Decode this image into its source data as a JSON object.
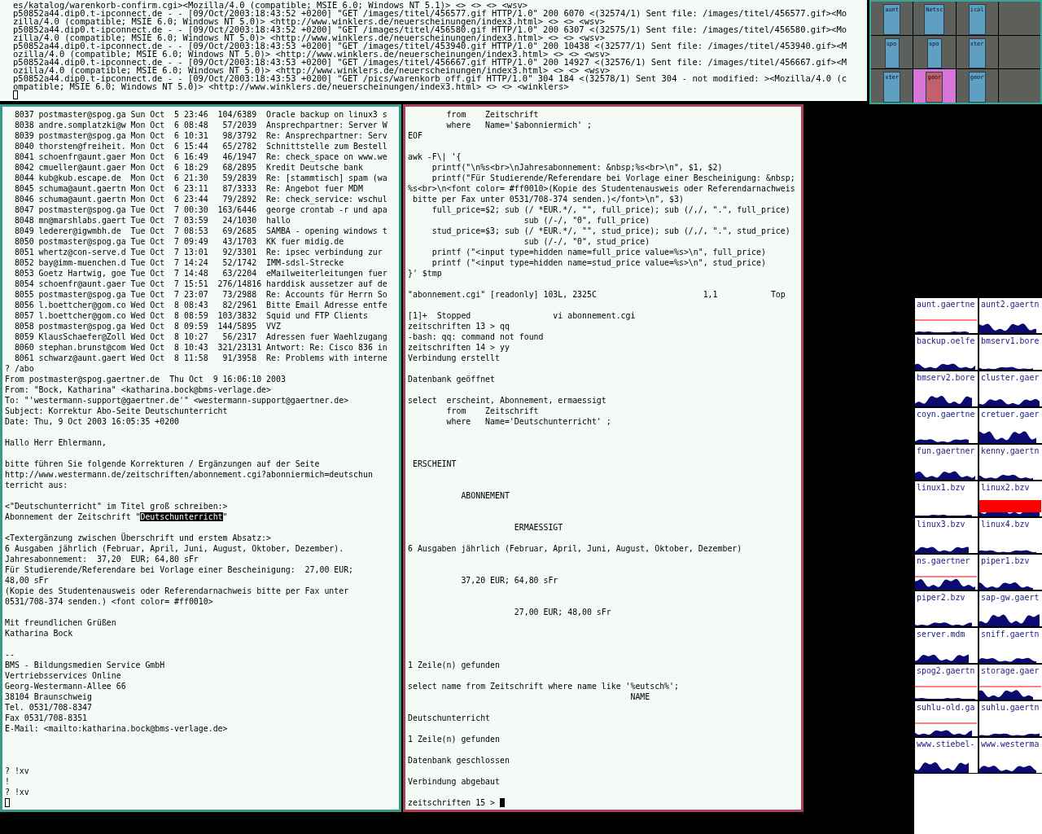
{
  "log_terminal": {
    "lines": [
      "es/katalog/warenkorb-confirm.cgi><Mozilla/4.0 (compatible; MSIE 6.0; Windows NT 5.1)> <> <> <> <wsv>",
      "p50852a44.dip0.t-ipconnect.de - - [09/Oct/2003:18:43:52 +0200] \"GET /images/titel/456577.gif HTTP/1.0\" 200 6070 <(32574/1) Sent file: /images/titel/456577.gif><Mo",
      "zilla/4.0 (compatible; MSIE 6.0; Windows NT 5.0)> <http://www.winklers.de/neuerscheinungen/index3.html> <> <> <wsv>",
      "p50852a44.dip0.t-ipconnect.de - - [09/Oct/2003:18:43:52 +0200] \"GET /images/titel/456580.gif HTTP/1.0\" 200 6307 <(32575/1) Sent file: /images/titel/456580.gif><Mo",
      "zilla/4.0 (compatible; MSIE 6.0; Windows NT 5.0)> <http://www.winklers.de/neuerscheinungen/index3.html> <> <> <wsv>",
      "p50852a44.dip0.t-ipconnect.de - - [09/Oct/2003:18:43:53 +0200] \"GET /images/titel/453940.gif HTTP/1.0\" 200 10438 <(32577/1) Sent file: /images/titel/453940.gif><M",
      "ozilla/4.0 (compatible; MSIE 6.0; Windows NT 5.0)> <http://www.winklers.de/neuerscheinungen/index3.html> <> <> <wsv>",
      "p50852a44.dip0.t-ipconnect.de - - [09/Oct/2003:18:43:53 +0200] \"GET /images/titel/456667.gif HTTP/1.0\" 200 14927 <(32576/1) Sent file: /images/titel/456667.gif><M",
      "ozilla/4.0 (compatible; MSIE 6.0; Windows NT 5.0)> <http://www.winklers.de/neuerscheinungen/index3.html> <> <> <wsv>",
      "p50852a44.dip0.t-ipconnect.de - - [09/Oct/2003:18:43:53 +0200] \"GET /pics/warenkorb_off.gif HTTP/1.0\" 304 184 <(32578/1) Sent 304 - not modified: ><Mozilla/4.0 (c",
      "ompatible; MSIE 6.0; Windows NT 5.0)> <http://www.winklers.de/neuerscheinungen/index3.html> <> <> <winklers>"
    ]
  },
  "pager": {
    "desks": [
      {
        "selected": false,
        "windows": [
          {
            "label": "aunt",
            "focused": false
          }
        ]
      },
      {
        "selected": false,
        "windows": [
          {
            "label": "Netsc",
            "focused": false
          }
        ]
      },
      {
        "selected": false,
        "windows": [
          {
            "label": "ical",
            "focused": false
          }
        ]
      },
      {
        "selected": false
      },
      {
        "selected": false,
        "windows": [
          {
            "label": "spo",
            "focused": false
          }
        ]
      },
      {
        "selected": false,
        "windows": [
          {
            "label": "spo",
            "focused": false
          }
        ]
      },
      {
        "selected": false,
        "windows": [
          {
            "label": "xter",
            "focused": false
          }
        ]
      },
      {
        "selected": false
      },
      {
        "selected": false,
        "windows": [
          {
            "label": "xter",
            "focused": false
          }
        ]
      },
      {
        "selected": true,
        "windows": [
          {
            "label": "geor",
            "focused": true
          }
        ]
      },
      {
        "selected": false,
        "windows": [
          {
            "label": "geor",
            "focused": false
          }
        ]
      },
      {
        "selected": false
      }
    ]
  },
  "terminals": [
    {
      "focused": false,
      "blocks": [
        {
          "kind": "tight",
          "lines": [
            "  8037 postmaster@spog.ga Sun Oct  5 23:46  104/6389  Oracle backup on linux3 s",
            "  8038 andre.somplatzki@w Mon Oct  6 08:48   57/2039  Ansprechpartner: Server W",
            "  8039 postmaster@spog.ga Mon Oct  6 10:31   98/3792  Re: Ansprechpartner: Serv",
            "  8040 thorsten@freiheit. Mon Oct  6 15:44   65/2782  Schnittstelle zum Bestell",
            "  8041 schoenfr@aunt.gaer Mon Oct  6 16:49   46/1947  Re: check_space on www.we",
            "  8042 cmueller@aunt.gaer Mon Oct  6 18:29   68/2895  Kredit Deutsche bank",
            "  8044 kub@kub.escape.de  Mon Oct  6 21:30   59/2839  Re: [stammtisch] spam (wa",
            "  8045 schuma@aunt.gaertn Mon Oct  6 23:11   87/3333  Re: Angebot fuer MDM",
            "  8046 schuma@aunt.gaertn Mon Oct  6 23:44   79/2892  Re: check_service: wschul",
            "  8047 postmaster@spog.ga Tue Oct  7 00:30  163/6446  george crontab -r und apa",
            "  8048 mn@marshlabs.gaert Tue Oct  7 03:59   24/1030  hallo",
            "  8049 lederer@igwmbh.de  Tue Oct  7 08:53   69/2685  SAMBA - opening windows t",
            "  8050 postmaster@spog.ga Tue Oct  7 09:49   43/1703  KK fuer midig.de",
            "  8051 whertz@con-serve.d Tue Oct  7 13:01   92/3301  Re: ipsec verbindung zur",
            "  8052 bay@imm-muenchen.d Tue Oct  7 14:24   52/1742  IMM-sdsl-Strecke",
            "  8053 Goetz Hartwig, goe Tue Oct  7 14:48   63/2204  eMailweiterleitungen fuer",
            "  8054 schoenfr@aunt.gaer Tue Oct  7 15:51  276/14816 harddisk aussetzer auf de",
            "  8055 postmaster@spog.ga Tue Oct  7 23:07   73/2988  Re: Accounts für Herrn So",
            "  8056 l.boettcher@gom.co Wed Oct  8 08:43   82/2961  Bitte Email Adresse entfe",
            "  8057 l.boettcher@gom.co Wed Oct  8 08:59  103/3832  Squid und FTP Clients",
            "  8058 postmaster@spog.ga Wed Oct  8 09:59  144/5895  VVZ",
            "  8059 KlausSchaefer@Zoll Wed Oct  8 10:27   56/2317  Adressen fuer Waehlzugang",
            "  8060 stephan.brunst@com Wed Oct  8 10:43  321/23131 Antwort: Re: Cisco 836 in",
            "  8061 schwarz@aunt.gaert Wed Oct  8 11:58   91/3958  Re: Problems with interne",
            "? /abo",
            "From postmaster@spog.gaertner.de  Thu Oct  9 16:06:10 2003",
            "From: \"Bock, Katharina\" <katharina.bock@bms-verlage.de>",
            "To: \"'westermann-support@gaertner.de'\" <westermann-support@gaertner.de>",
            "Subject: Korrektur Abo-Seite Deutschunterricht",
            "Date: Thu, 9 Oct 2003 16:05:35 +0200"
          ]
        },
        {
          "kind": "single",
          "lines": [
            "Hallo Herr Ehlermann,"
          ]
        },
        {
          "kind": "single",
          "lines": [
            "bitte führen Sie folgende Korrekturen / Ergänzungen auf der Seite",
            "http://www.westermann.de/zeitschriften/abonnement.cgi?abonniermich=deutschun",
            "terricht aus:"
          ]
        },
        {
          "kind": "single",
          "lines": [
            "<\"Deutschunterricht\" im Titel groß schreiben:>",
            {
              "before": "Abonnement der Zeitschrift \"",
              "selection": "Deutschunterricht",
              "after": "\""
            }
          ]
        },
        {
          "kind": "single",
          "lines": [
            "<Textergänzung zwischen Überschrift und erstem Absatz:>",
            "6 Ausgaben jährlich (Februar, April, Juni, August, Oktober, Dezember).",
            "Jahresabonnement:  37,20  EUR; 64,80 sFr",
            "Für Studierende/Referendare bei Vorlage einer Bescheinigung:  27,00 EUR;",
            "48,00 sFr",
            "(Kopie des Studentenausweis oder Referendarnachweis bitte per Fax unter",
            "0531/708-374 senden.) <font color= #ff0010>"
          ]
        },
        {
          "kind": "single",
          "lines": [
            "Mit freundlichen Grüßen",
            "Katharina Bock"
          ]
        },
        {
          "kind": "single",
          "lines": [
            "--",
            "BMS - Bildungsmedien Service GmbH",
            "Vertriebsservices Online",
            "Georg-Westermann-Allee 66",
            "38104 Braunschweig",
            "Tel. 0531/708-8347",
            "Fax 0531/708-8351",
            "E-Mail: <mailto:katharina.bock@bms-verlage.de>"
          ]
        },
        {
          "kind": "triple",
          "lines": [
            "? !xv",
            "!",
            "? !xv"
          ]
        }
      ],
      "cursor_line": {
        "kind": "tight"
      }
    },
    {
      "focused": true,
      "blocks": [
        {
          "kind": "tight",
          "lines": [
            "        from    Zeitschrift",
            "        where   Name='$abonniermich' ;",
            "EOF"
          ]
        },
        {
          "kind": "single",
          "lines": [
            "awk -F\\| '{",
            "     printf(\"\\n%s<br>\\nJahresabonnement: &nbsp;%s<br>\\n\", $1, $2)",
            "     printf(\"Für Studierende/Referendare bei Vorlage einer Bescheinigung: &nbsp;",
            "%s<br>\\n<font color= #ff0010>(Kopie des Studentenausweis oder Referendarnachweis",
            " bitte per Fax unter 0531/708-374 senden.)</font>\\n\", $3)",
            "     full_price=$2; sub (/ *EUR.*/, \"\", full_price); sub (/,/, \".\", full_price)",
            "                        sub (/-/, \"0\", full_price)",
            "     stud_price=$3; sub (/ *EUR.*/, \"\", stud_price); sub (/,/, \".\", stud_price)",
            "                        sub (/-/, \"0\", stud_price)",
            "     printf (\"<input type=hidden name=full_price value=%s>\\n\", full_price)",
            "     printf (\"<input type=hidden name=stud_price value=%s>\\n\", stud_price)",
            "}' $tmp"
          ]
        },
        {
          "kind": "single",
          "lines": [
            "\"abonnement.cgi\" [readonly] 103L, 2325C                      1,1           Top"
          ]
        },
        {
          "kind": "single",
          "lines": [
            "[1]+  Stopped                 vi abonnement.cgi",
            "zeitschriften 13 > qq",
            "-bash: qq: command not found",
            "zeitschriften 14 > yy",
            "Verbindung erstellt"
          ]
        },
        {
          "kind": "single",
          "lines": [
            "Datenbank geöffnet"
          ]
        },
        {
          "kind": "single",
          "lines": [
            "select  erscheint, Abonnement, ermaessigt",
            "        from    Zeitschrift",
            "        where   Name='Deutschunterricht' ;"
          ]
        },
        {
          "kind": "triple",
          "lines": [
            " ERSCHEINT"
          ]
        },
        {
          "kind": "double",
          "lines": [
            "           ABONNEMENT"
          ]
        },
        {
          "kind": "double",
          "lines": [
            "                      ERMAESSIGT"
          ]
        },
        {
          "kind": "single",
          "lines": [
            "6 Ausgaben jährlich (Februar, April, Juni, August, Oktober, Dezember)"
          ]
        },
        {
          "kind": "double",
          "lines": [
            "           37,20 EUR; 64,80 sFr"
          ]
        },
        {
          "kind": "double",
          "lines": [
            "                      27,00 EUR; 48,00 sFr"
          ]
        },
        {
          "kind": "quadruple",
          "lines": [
            "1 Zeile(n) gefunden"
          ]
        },
        {
          "kind": "single",
          "lines": [
            "select name from Zeitschrift where name like '%eutsch%';",
            "                                              NAME"
          ]
        },
        {
          "kind": "single",
          "lines": [
            "Deutschunterricht"
          ]
        },
        {
          "kind": "single",
          "lines": [
            "1 Zeile(n) gefunden"
          ]
        },
        {
          "kind": "single",
          "lines": [
            "Datenbank geschlossen"
          ]
        },
        {
          "kind": "single",
          "lines": [
            "Verbindung abgebaut"
          ]
        }
      ],
      "cursor_line": {
        "kind": "single",
        "prompt": "zeitschriften 15 >"
      }
    }
  ],
  "monitors": [
    {
      "host": "aunt.gaertne",
      "alarm": false,
      "limit_line": true
    },
    {
      "host": "aunt2.gaertn",
      "alarm": false,
      "limit_line": false
    },
    {
      "host": "backup.oelfe",
      "alarm": false,
      "limit_line": false
    },
    {
      "host": "bmserv1.bore",
      "alarm": false,
      "limit_line": false
    },
    {
      "host": "bmserv2.bore",
      "alarm": false,
      "limit_line": false
    },
    {
      "host": "cluster.gaer",
      "alarm": false,
      "limit_line": false
    },
    {
      "host": "coyn.gaertne",
      "alarm": false,
      "limit_line": false
    },
    {
      "host": "cretuer.gaer",
      "alarm": false,
      "limit_line": false
    },
    {
      "host": "fun.gaertner",
      "alarm": false,
      "limit_line": false
    },
    {
      "host": "kenny.gaertn",
      "alarm": false,
      "limit_line": false
    },
    {
      "host": "linux1.bzv",
      "alarm": false,
      "limit_line": false
    },
    {
      "host": "linux2.bzv",
      "alarm": true,
      "limit_line": false
    },
    {
      "host": "linux3.bzv",
      "alarm": false,
      "limit_line": false
    },
    {
      "host": "linux4.bzv",
      "alarm": false,
      "limit_line": false
    },
    {
      "host": "ns.gaertner",
      "alarm": false,
      "limit_line": true
    },
    {
      "host": "piper1.bzv",
      "alarm": false,
      "limit_line": false
    },
    {
      "host": "piper2.bzv",
      "alarm": false,
      "limit_line": false
    },
    {
      "host": "sap-gw.gaert",
      "alarm": false,
      "limit_line": false
    },
    {
      "host": "server.mdm",
      "alarm": false,
      "limit_line": false
    },
    {
      "host": "sniff.gaertn",
      "alarm": false,
      "limit_line": false
    },
    {
      "host": "spog2.gaertn",
      "alarm": false,
      "limit_line": true
    },
    {
      "host": "storage.gaer",
      "alarm": false,
      "limit_line": true
    },
    {
      "host": "suhlu-old.ga",
      "alarm": false,
      "limit_line": true
    },
    {
      "host": "suhlu.gaertn",
      "alarm": false,
      "limit_line": false
    },
    {
      "host": "www.stiebel-",
      "alarm": false,
      "limit_line": false
    },
    {
      "host": "www.westerma",
      "alarm": false,
      "limit_line": false
    }
  ]
}
